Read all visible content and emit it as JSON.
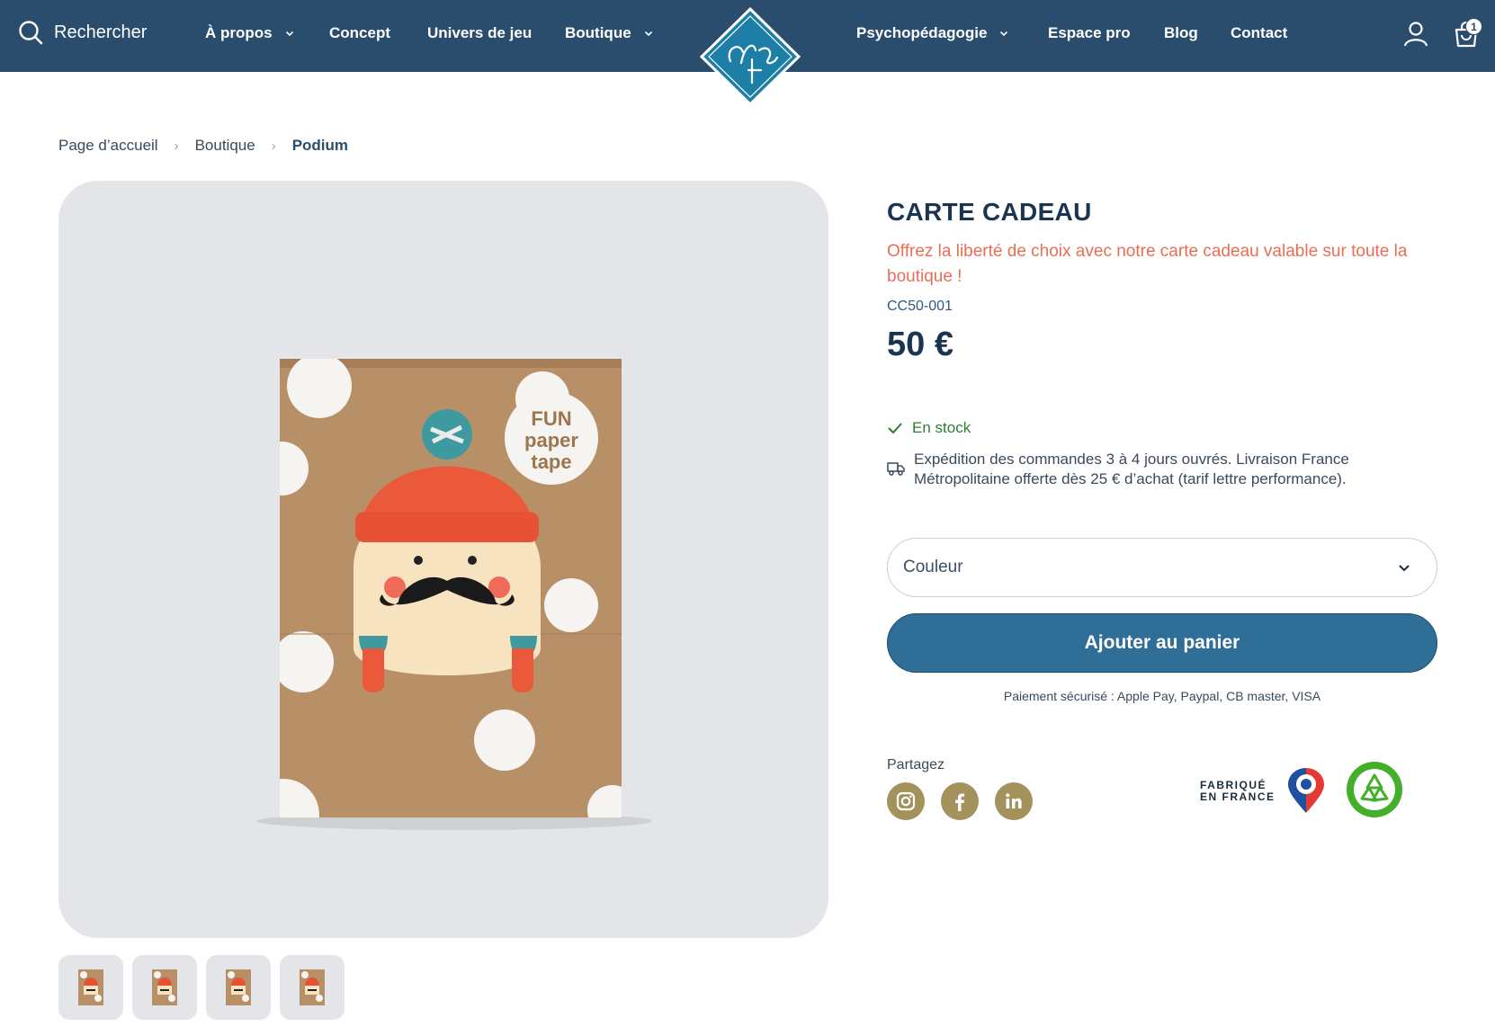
{
  "header": {
    "search_label": "Rechercher",
    "nav_left": [
      {
        "label": "À propos",
        "dropdown": true
      },
      {
        "label": "Concept",
        "dropdown": false
      },
      {
        "label": "Univers de jeu",
        "dropdown": false
      },
      {
        "label": "Boutique",
        "dropdown": true
      }
    ],
    "nav_right": [
      {
        "label": "Psychopédagogie",
        "dropdown": true
      },
      {
        "label": "Espace pro",
        "dropdown": false
      },
      {
        "label": "Blog",
        "dropdown": false
      },
      {
        "label": "Contact",
        "dropdown": false
      }
    ],
    "cart_count": "1",
    "colors": {
      "bar": "#2a4d6e",
      "logo": "#1d7fa6"
    }
  },
  "breadcrumb": {
    "items": [
      "Page d’accueil",
      "Boutique"
    ],
    "current": "Podium",
    "separator": "›"
  },
  "gallery": {
    "main_image_text": [
      "FUN",
      "paper",
      "tape"
    ],
    "thumbnail_count": 4
  },
  "product": {
    "title": "CARTE CADEAU",
    "description": "Offrez la liberté de choix avec notre carte cadeau valable sur toute la boutique !",
    "sku": "CC50-001",
    "price": "50 €",
    "stock": "En stock",
    "shipping": "Expédition des commandes 3 à 4 jours ouvrés. Livraison France Métropolitaine offerte dès 25 € d’achat (tarif lettre performance).",
    "variant_select": {
      "selected": "Couleur"
    },
    "add_to_cart": "Ajouter au panier",
    "secure_payment": "Paiement sécurisé : Apple Pay, Paypal, CB master, VISA",
    "share_label": "Partagez",
    "social_icons": [
      "instagram-icon",
      "facebook-icon",
      "linkedin-icon"
    ],
    "badges": {
      "made_in_france": [
        "FABRIQUÉ",
        "EN FRANCE"
      ]
    },
    "colors": {
      "title": "#1a3550",
      "description": "#e96e55",
      "stock": "#2e7d32",
      "button": "#2f6e96",
      "social": "#a4925c"
    }
  }
}
